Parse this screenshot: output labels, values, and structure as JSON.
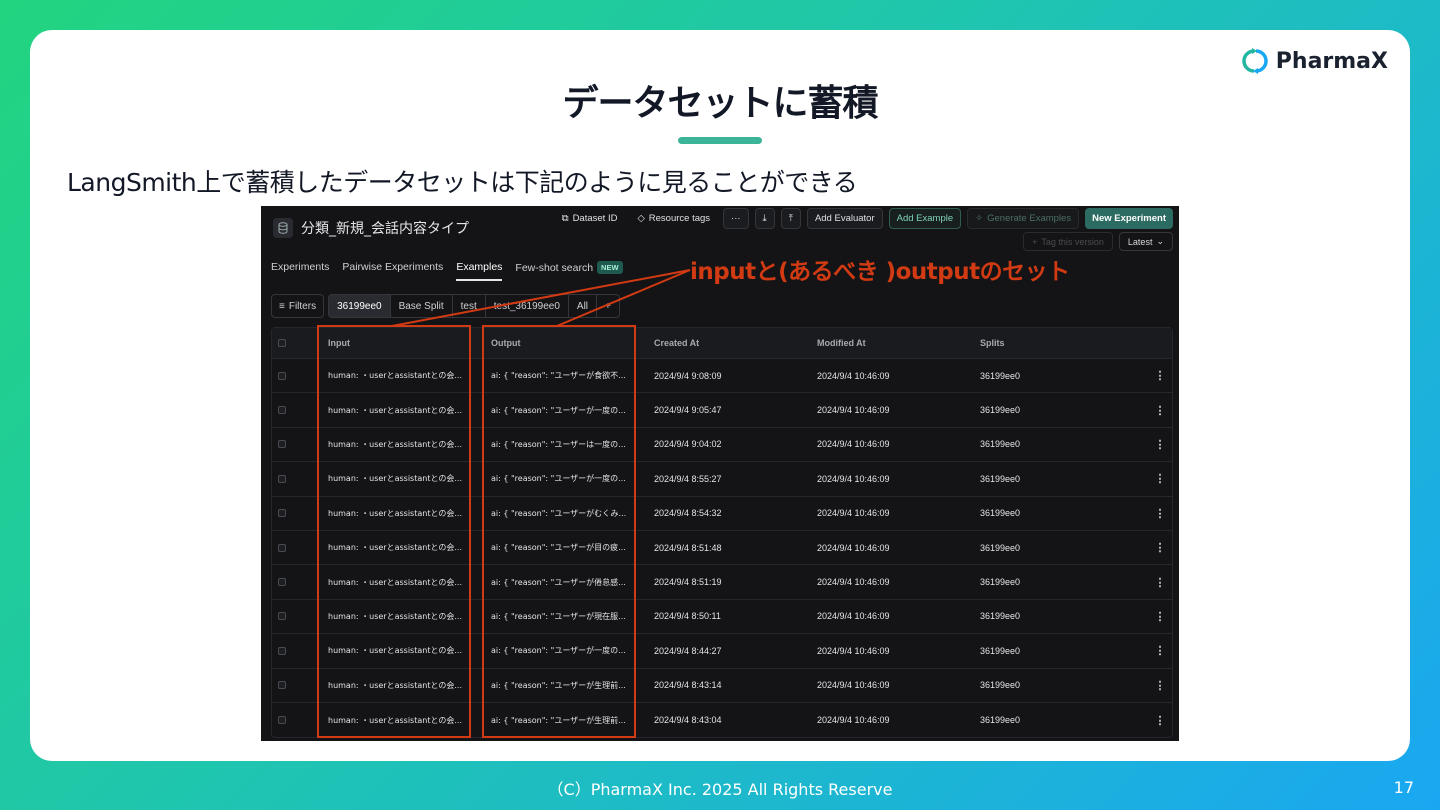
{
  "slide": {
    "logo_text": "PharmaX",
    "title": "データセットに蓄積",
    "subtitle": "LangSmith上で蓄積したデータセットは下記のように見ることができる",
    "footer": "（C）PharmaX Inc. 2025  All Rights Reserve",
    "page_number": "17",
    "annotation": "inputと(あるべき )outputのセット",
    "colors": {
      "accent": "#3cb49a",
      "highlight": "#d13a12"
    }
  },
  "app": {
    "dataset_name": "分類_新規_会話内容タイプ",
    "toolbar": {
      "dataset_id": "Dataset ID",
      "resource_tags": "Resource tags",
      "more": "···",
      "add_evaluator": "Add Evaluator",
      "add_example": "Add Example",
      "generate_examples": "Generate Examples",
      "new_experiment": "New Experiment",
      "tag_version": "Tag this version",
      "latest": "Latest"
    },
    "tabs": [
      "Experiments",
      "Pairwise Experiments",
      "Examples",
      "Few-shot search"
    ],
    "new_badge": "NEW",
    "filters_label": "Filters",
    "splits": [
      "36199ee0",
      "Base Split",
      "test",
      "test_36199ee0",
      "All"
    ],
    "add_split": "+",
    "columns": [
      "Input",
      "Output",
      "Created At",
      "Modified At",
      "Splits"
    ],
    "rows": [
      {
        "input": "human: ・userとassistantとの会...",
        "output": "ai: { \"reason\": \"ユーザーが食欲不...",
        "created": "2024/9/4 9:08:09",
        "modified": "2024/9/4 10:46:09",
        "split": "36199ee0"
      },
      {
        "input": "human: ・userとassistantとの会...",
        "output": "ai: { \"reason\": \"ユーザーが一度の...",
        "created": "2024/9/4 9:05:47",
        "modified": "2024/9/4 10:46:09",
        "split": "36199ee0"
      },
      {
        "input": "human: ・userとassistantとの会...",
        "output": "ai: { \"reason\": \"ユーザーは一度の...",
        "created": "2024/9/4 9:04:02",
        "modified": "2024/9/4 10:46:09",
        "split": "36199ee0"
      },
      {
        "input": "human: ・userとassistantとの会...",
        "output": "ai: { \"reason\": \"ユーザーが一度の...",
        "created": "2024/9/4 8:55:27",
        "modified": "2024/9/4 10:46:09",
        "split": "36199ee0"
      },
      {
        "input": "human: ・userとassistantとの会...",
        "output": "ai: { \"reason\": \"ユーザーがむくみ...",
        "created": "2024/9/4 8:54:32",
        "modified": "2024/9/4 10:46:09",
        "split": "36199ee0"
      },
      {
        "input": "human: ・userとassistantとの会...",
        "output": "ai: { \"reason\": \"ユーザーが目の疲...",
        "created": "2024/9/4 8:51:48",
        "modified": "2024/9/4 10:46:09",
        "split": "36199ee0"
      },
      {
        "input": "human: ・userとassistantとの会...",
        "output": "ai: { \"reason\": \"ユーザーが倦怠感...",
        "created": "2024/9/4 8:51:19",
        "modified": "2024/9/4 10:46:09",
        "split": "36199ee0"
      },
      {
        "input": "human: ・userとassistantとの会...",
        "output": "ai: { \"reason\": \"ユーザーが現在服...",
        "created": "2024/9/4 8:50:11",
        "modified": "2024/9/4 10:46:09",
        "split": "36199ee0"
      },
      {
        "input": "human: ・userとassistantとの会...",
        "output": "ai: { \"reason\": \"ユーザーが一度の...",
        "created": "2024/9/4 8:44:27",
        "modified": "2024/9/4 10:46:09",
        "split": "36199ee0"
      },
      {
        "input": "human: ・userとassistantとの会...",
        "output": "ai: { \"reason\": \"ユーザーが生理前...",
        "created": "2024/9/4 8:43:14",
        "modified": "2024/9/4 10:46:09",
        "split": "36199ee0"
      },
      {
        "input": "human: ・userとassistantとの会...",
        "output": "ai: { \"reason\": \"ユーザーが生理前...",
        "created": "2024/9/4 8:43:04",
        "modified": "2024/9/4 10:46:09",
        "split": "36199ee0"
      }
    ]
  }
}
